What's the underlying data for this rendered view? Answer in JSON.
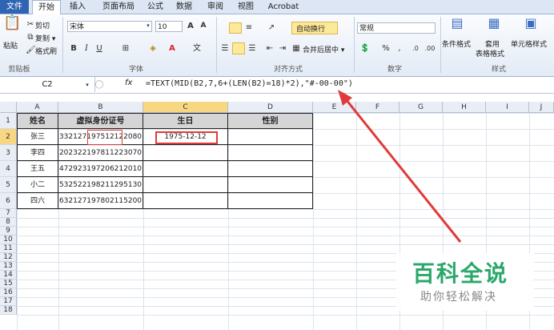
{
  "menu": {
    "file": "文件",
    "tabs": [
      "开始",
      "插入",
      "页面布局",
      "公式",
      "数据",
      "审阅",
      "视图",
      "Acrobat"
    ]
  },
  "clipboard": {
    "paste": "粘贴",
    "cut": "剪切",
    "copy": "复制 ▾",
    "format_painter": "格式刷",
    "group": "剪贴板"
  },
  "font": {
    "name": "宋体",
    "size": "10",
    "group": "字体"
  },
  "alignment": {
    "wrap": "自动换行",
    "merge": "合并后居中 ▾",
    "group": "对齐方式"
  },
  "number": {
    "format": "常规",
    "group": "数字"
  },
  "styles": {
    "cond": "条件格式",
    "table_1": "套用",
    "table_2": "表格格式",
    "cell_style": "单元格样式",
    "group": "样式"
  },
  "formula_bar": {
    "cell_ref": "C2",
    "fx": "fx",
    "formula": "=TEXT(MID(B2,7,6+(LEN(B2)=18)*2),\"#-00-00\")"
  },
  "columns": [
    "A",
    "B",
    "C",
    "D",
    "E",
    "F",
    "G",
    "H",
    "I",
    "J"
  ],
  "rows": [
    "1",
    "2",
    "3",
    "4",
    "5",
    "6",
    "7",
    "8",
    "9",
    "10",
    "11",
    "12",
    "13",
    "14",
    "15",
    "16",
    "17",
    "18"
  ],
  "table": {
    "headers": [
      "姓名",
      "虚拟身份证号",
      "生日",
      "性别"
    ],
    "data": [
      [
        "张三",
        "332127197512122080",
        "1975-12-12",
        ""
      ],
      [
        "李四",
        "202322197811223070",
        "",
        ""
      ],
      [
        "王五",
        "472923197206212010",
        "",
        ""
      ],
      [
        "小二",
        "532522198211295130",
        "",
        ""
      ],
      [
        "四六",
        "632127197802115200",
        "",
        ""
      ]
    ]
  },
  "watermark": {
    "title": "百科全说",
    "subtitle": "助你轻松解决"
  },
  "colors": {
    "accent": "#e03a3a",
    "selected_header": "#f8d782",
    "file_tab": "#2f64b4"
  }
}
